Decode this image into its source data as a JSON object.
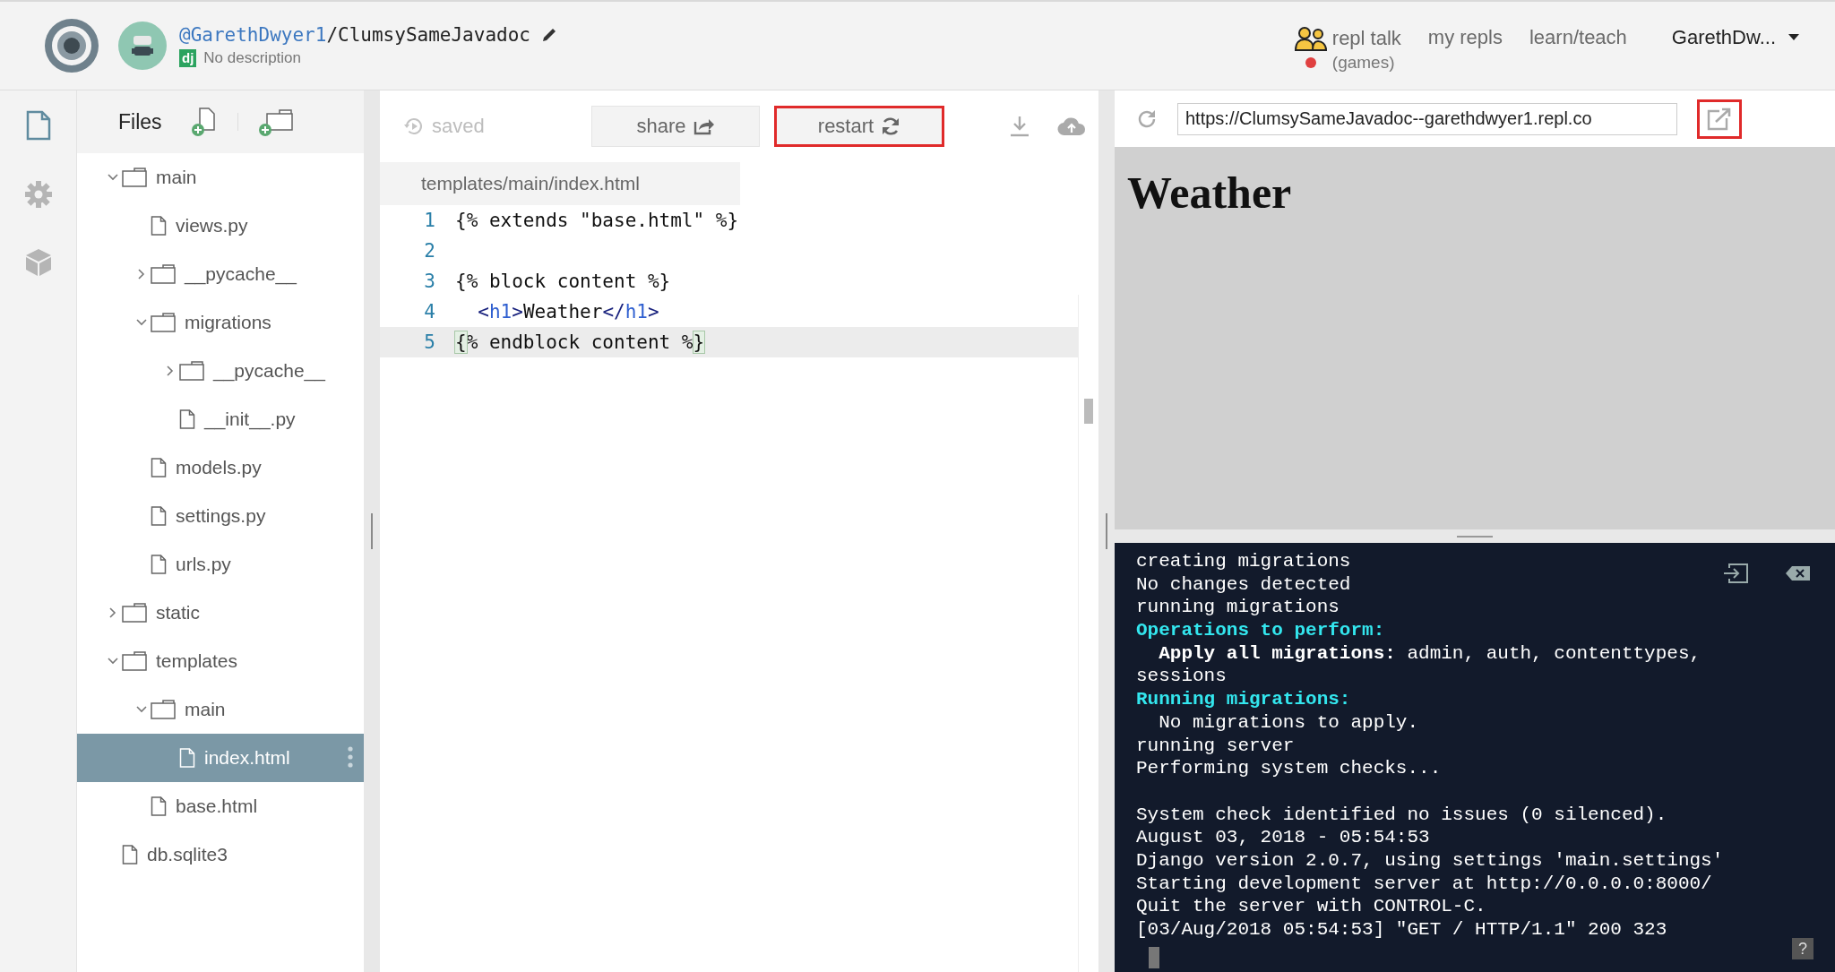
{
  "header": {
    "owner": "@GarethDwyer1",
    "repl_name": "/ClumsySameJavadoc",
    "language_badge": "dj",
    "description": "No description",
    "nav": [
      {
        "kind": "talk",
        "label": "repl talk",
        "sublabel": "(games)",
        "notification": true
      },
      {
        "kind": "link",
        "label": "my repls"
      },
      {
        "kind": "link",
        "label": "learn/teach"
      }
    ],
    "user_menu": "GarethDw..."
  },
  "rail": [
    {
      "kind": "files",
      "selected": true
    },
    {
      "kind": "settings",
      "selected": false
    },
    {
      "kind": "packages",
      "selected": false
    }
  ],
  "files": {
    "title": "Files",
    "tree": [
      {
        "name": "main",
        "kind": "folder",
        "expanded": true,
        "selected": false,
        "children": [
          {
            "name": "views.py",
            "kind": "file",
            "selected": false
          },
          {
            "name": "__pycache__",
            "kind": "folder",
            "expanded": false,
            "selected": false
          },
          {
            "name": "migrations",
            "kind": "folder",
            "expanded": true,
            "selected": false,
            "children": [
              {
                "name": "__pycache__",
                "kind": "folder",
                "expanded": false,
                "selected": false
              },
              {
                "name": "__init__.py",
                "kind": "file",
                "selected": false
              }
            ]
          },
          {
            "name": "models.py",
            "kind": "file",
            "selected": false
          },
          {
            "name": "settings.py",
            "kind": "file",
            "selected": false
          },
          {
            "name": "urls.py",
            "kind": "file",
            "selected": false
          }
        ]
      },
      {
        "name": "static",
        "kind": "folder",
        "expanded": false,
        "selected": false
      },
      {
        "name": "templates",
        "kind": "folder",
        "expanded": true,
        "selected": false,
        "children": [
          {
            "name": "main",
            "kind": "folder",
            "expanded": true,
            "selected": false,
            "children": [
              {
                "name": "index.html",
                "kind": "file",
                "selected": true
              }
            ]
          },
          {
            "name": "base.html",
            "kind": "file",
            "selected": false
          }
        ]
      },
      {
        "name": "db.sqlite3",
        "kind": "file",
        "selected": false
      }
    ]
  },
  "editor": {
    "status": "saved",
    "buttons": [
      {
        "kind": "share",
        "label": "share",
        "highlighted": false
      },
      {
        "kind": "restart",
        "label": "restart",
        "highlighted": true
      }
    ],
    "tab": "templates/main/index.html",
    "lines": [
      {
        "number": "1",
        "active": false,
        "tokens": [
          {
            "kind": "plain",
            "text": "{% extends \"base.html\" %}"
          }
        ]
      },
      {
        "number": "2",
        "active": false
      },
      {
        "number": "3",
        "active": false,
        "tokens": [
          {
            "kind": "plain",
            "text": "{% block content %}"
          }
        ]
      },
      {
        "number": "4",
        "active": false,
        "indented": true,
        "tokens": [
          {
            "kind": "punct",
            "text": "<"
          },
          {
            "kind": "tag",
            "text": "h1"
          },
          {
            "kind": "punct",
            "text": ">"
          },
          {
            "kind": "plain",
            "text": "Weather"
          },
          {
            "kind": "punct",
            "text": "</"
          },
          {
            "kind": "tag",
            "text": "h1"
          },
          {
            "kind": "punct",
            "text": ">"
          }
        ]
      },
      {
        "number": "5",
        "active": true,
        "tokens": [
          {
            "kind": "match",
            "text": "{"
          },
          {
            "kind": "plain",
            "text": "% endblock content %"
          },
          {
            "kind": "match",
            "text": "}"
          }
        ]
      }
    ]
  },
  "preview": {
    "url": "https://ClumsySameJavadoc--garethdwyer1.repl.co",
    "open_highlighted": true,
    "heading": "Weather"
  },
  "console": {
    "help": "?",
    "lines": [
      {
        "kind": "text",
        "segments": [
          {
            "kind": "plain",
            "text": "creating migrations"
          }
        ]
      },
      {
        "kind": "text",
        "segments": [
          {
            "kind": "plain",
            "text": "No changes detected"
          }
        ]
      },
      {
        "kind": "text",
        "segments": [
          {
            "kind": "plain",
            "text": "running migrations"
          }
        ]
      },
      {
        "kind": "text",
        "segments": [
          {
            "kind": "heading",
            "text": "Operations to perform:"
          }
        ]
      },
      {
        "kind": "text",
        "segments": [
          {
            "kind": "bold",
            "text": "  Apply all migrations:"
          },
          {
            "kind": "plain",
            "text": " admin, auth, contenttypes,"
          }
        ]
      },
      {
        "kind": "text",
        "segments": [
          {
            "kind": "plain",
            "text": "sessions"
          }
        ]
      },
      {
        "kind": "text",
        "segments": [
          {
            "kind": "heading",
            "text": "Running migrations:"
          }
        ]
      },
      {
        "kind": "text",
        "segments": [
          {
            "kind": "plain",
            "text": "  No migrations to apply."
          }
        ]
      },
      {
        "kind": "text",
        "segments": [
          {
            "kind": "plain",
            "text": "running server"
          }
        ]
      },
      {
        "kind": "text",
        "segments": [
          {
            "kind": "plain",
            "text": "Performing system checks..."
          }
        ]
      },
      {
        "kind": "blank"
      },
      {
        "kind": "text",
        "segments": [
          {
            "kind": "plain",
            "text": "System check identified no issues (0 silenced)."
          }
        ]
      },
      {
        "kind": "text",
        "segments": [
          {
            "kind": "plain",
            "text": "August 03, 2018 - 05:54:53"
          }
        ]
      },
      {
        "kind": "text",
        "segments": [
          {
            "kind": "plain",
            "text": "Django version 2.0.7, using settings 'main.settings'"
          }
        ]
      },
      {
        "kind": "text",
        "segments": [
          {
            "kind": "plain",
            "text": "Starting development server at http://0.0.0.0:8000/"
          }
        ]
      },
      {
        "kind": "text",
        "segments": [
          {
            "kind": "plain",
            "text": "Quit the server with CONTROL-C."
          }
        ]
      },
      {
        "kind": "text",
        "segments": [
          {
            "kind": "plain",
            "text": "[03/Aug/2018 05:54:53] \"GET / HTTP/1.1\" 200 323"
          }
        ]
      }
    ]
  }
}
